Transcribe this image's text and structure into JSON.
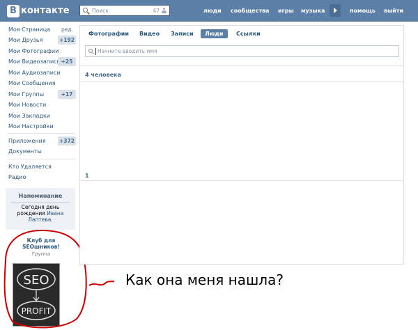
{
  "header": {
    "logo_letter": "В",
    "logo_text": "контакте",
    "search_placeholder": "Поиск",
    "search_count": "47",
    "nav": [
      "люди",
      "сообщества",
      "игры",
      "музыка",
      "помощь",
      "выйти"
    ]
  },
  "sidebar": {
    "items": [
      {
        "label": "Моя Страница",
        "extra": "ред."
      },
      {
        "label": "Мои Друзья",
        "badge": "+192"
      },
      {
        "label": "Мои Фотографии"
      },
      {
        "label": "Мои Видеозаписи",
        "badge": "+25"
      },
      {
        "label": "Мои Аудиозаписи"
      },
      {
        "label": "Мои Сообщения"
      },
      {
        "label": "Мои Группы",
        "badge": "+17"
      },
      {
        "label": "Мои Новости"
      },
      {
        "label": "Мои Закладки"
      },
      {
        "label": "Мои Настройки"
      },
      {
        "label": "Приложения",
        "badge": "+372"
      },
      {
        "label": "Документы"
      },
      {
        "label": "Кто Удаляется"
      },
      {
        "label": "Радио"
      }
    ],
    "reminder": {
      "title": "Напоминание",
      "text_today": "Сегодня",
      "text_day": "день",
      "text_birthday": "рождения",
      "name_first": "Ивана",
      "name_last": "Лаптева."
    },
    "club": {
      "title_line1": "Клуб для",
      "title_line2": "SEOшников!",
      "subtitle": "Группа",
      "image_text_top": "SEO",
      "image_text_bottom": "PROFIT"
    }
  },
  "main": {
    "tabs": [
      "Фотографии",
      "Видео",
      "Записи",
      "Люди",
      "Ссылки"
    ],
    "active_tab": "Люди",
    "search_placeholder": "Начните вводить имя",
    "people_count": "4 человека",
    "page": "1"
  },
  "annotation": "Как она меня нашла?",
  "colors": {
    "header_bg": "#5b7fa6",
    "link": "#2b587a",
    "badge_bg": "#dae1e8",
    "annotation_ring": "#cc0000"
  }
}
